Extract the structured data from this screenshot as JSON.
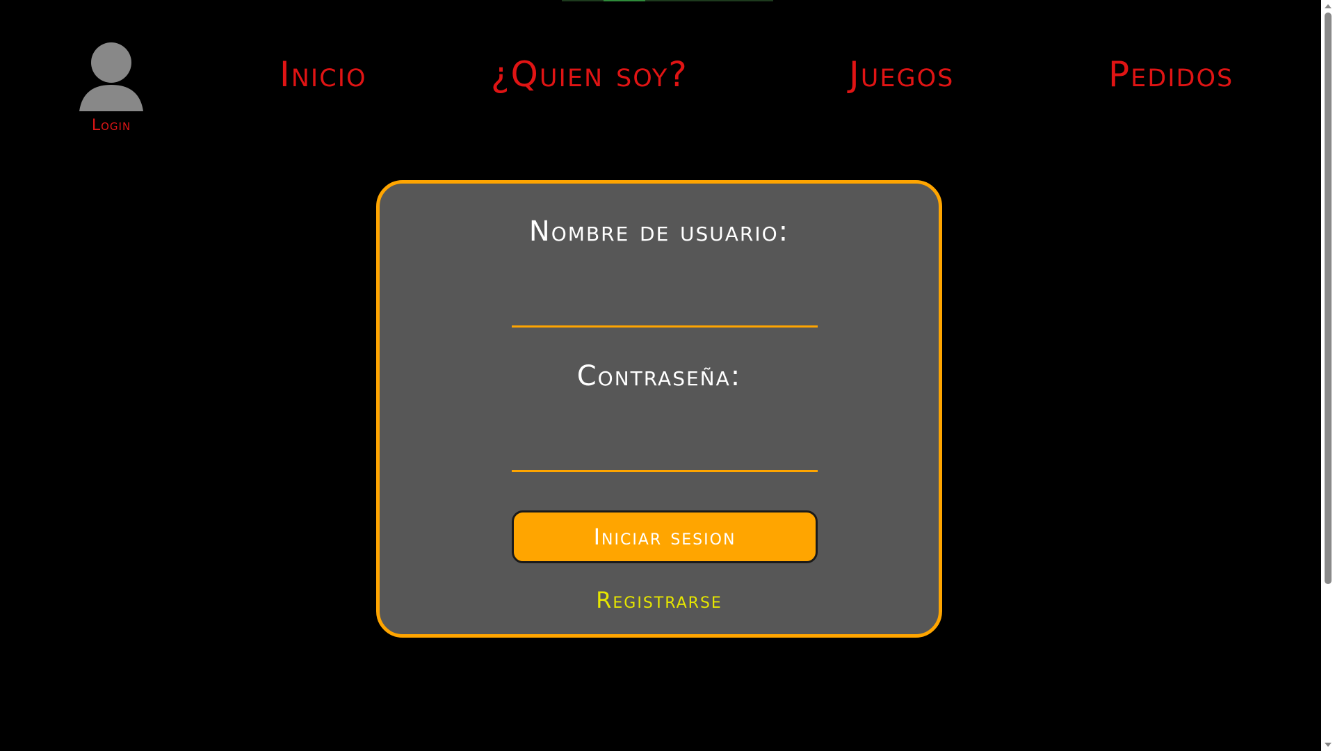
{
  "header": {
    "login": {
      "icon": "user-avatar-icon",
      "label": "Login"
    },
    "nav": {
      "inicio": "Inicio",
      "quien_soy": "¿Quien soy?",
      "juegos": "Juegos",
      "pedidos": "Pedidos"
    }
  },
  "login_form": {
    "username_label": "Nombre de usuario:",
    "username_value": "",
    "password_label": "Contraseña:",
    "password_value": "",
    "submit_label": "Iniciar sesion",
    "register_label": "Registrarse"
  },
  "colors": {
    "background": "#000000",
    "nav_text": "#e01414",
    "card_background": "#575757",
    "card_border": "#ffa500",
    "button_background": "#ffa500",
    "register_link": "#e6e600",
    "label_text": "#ffffff"
  }
}
